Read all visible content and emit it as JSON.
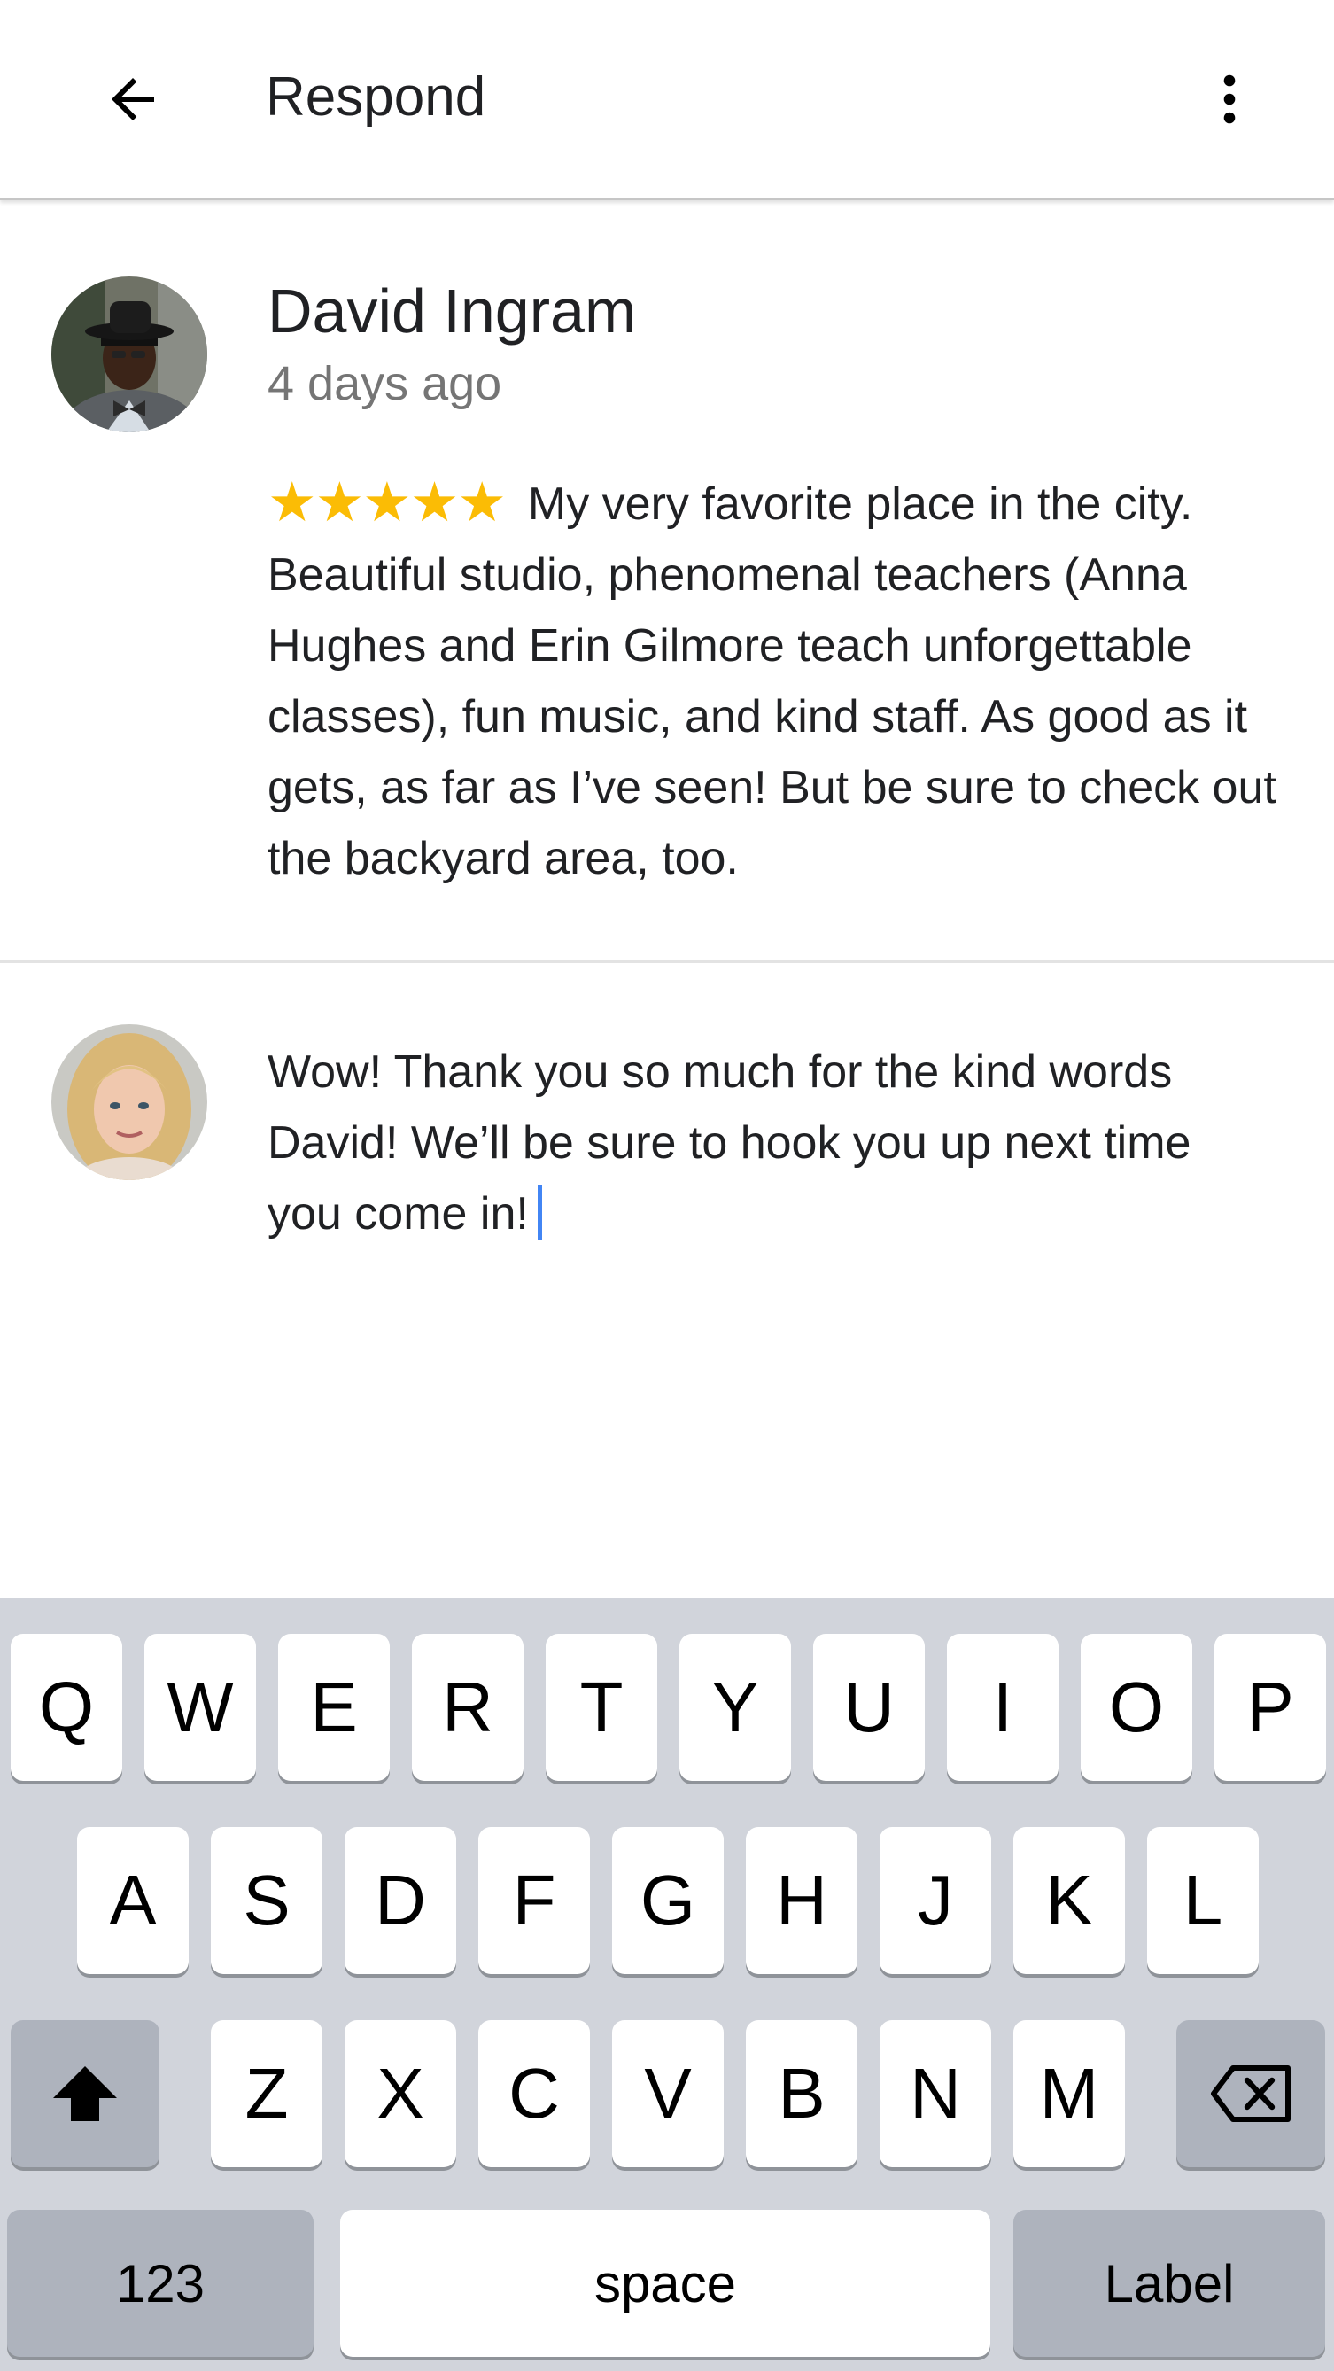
{
  "appbar": {
    "title": "Respond",
    "back_icon": "arrow-back-icon",
    "more_icon": "more-vert-icon"
  },
  "review": {
    "author": "David Ingram",
    "time": "4 days ago",
    "rating_stars": 5,
    "stars": "★★★★★",
    "text": "My very favorite place in the city. Beautiful studio, phenomenal teachers (Anna Hughes and Erin Gilmore teach unforgettable classes), fun music, and kind staff. As good as it gets, as far as I’ve seen! But be sure to check out the backyard area, too."
  },
  "reply": {
    "text": "Wow! Thank you so much for the kind words David! We’ll be sure to hook you up next time you come in!"
  },
  "keyboard": {
    "row1": [
      "Q",
      "W",
      "E",
      "R",
      "T",
      "Y",
      "U",
      "I",
      "O",
      "P"
    ],
    "row2": [
      "A",
      "S",
      "D",
      "F",
      "G",
      "H",
      "J",
      "K",
      "L"
    ],
    "row3": [
      "Z",
      "X",
      "C",
      "V",
      "B",
      "N",
      "M"
    ],
    "shift_icon": "shift-icon",
    "backspace_icon": "backspace-icon",
    "numbers_label": "123",
    "space_label": "space",
    "action_label": "Label"
  },
  "colors": {
    "star": "#fbbc05",
    "caret": "#4285f4",
    "keyboard_bg": "#d1d4db",
    "secondary_text": "#757575"
  }
}
